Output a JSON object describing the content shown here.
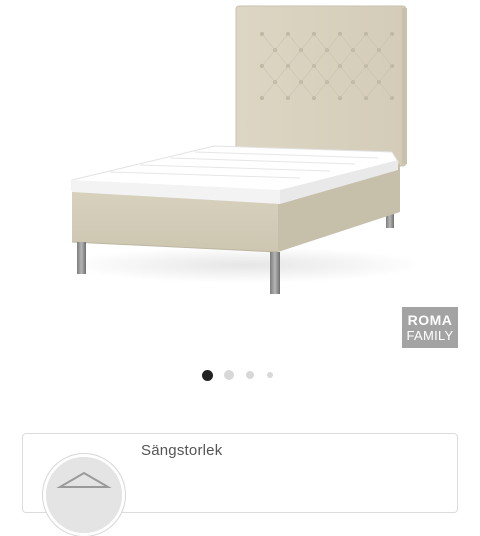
{
  "product": {
    "image_icon": "bed-product-image",
    "brand_badge": {
      "line1": "ROMA",
      "line2": "FAMILY",
      "color": "#a3a3a3"
    }
  },
  "carousel": {
    "total_slides": 4,
    "active_index": 0,
    "active_color": "#222222",
    "inactive_color": "#d8d8d8"
  },
  "options": {
    "size_label": "Sängstorlek",
    "size_icon": "bed-size-icon"
  }
}
